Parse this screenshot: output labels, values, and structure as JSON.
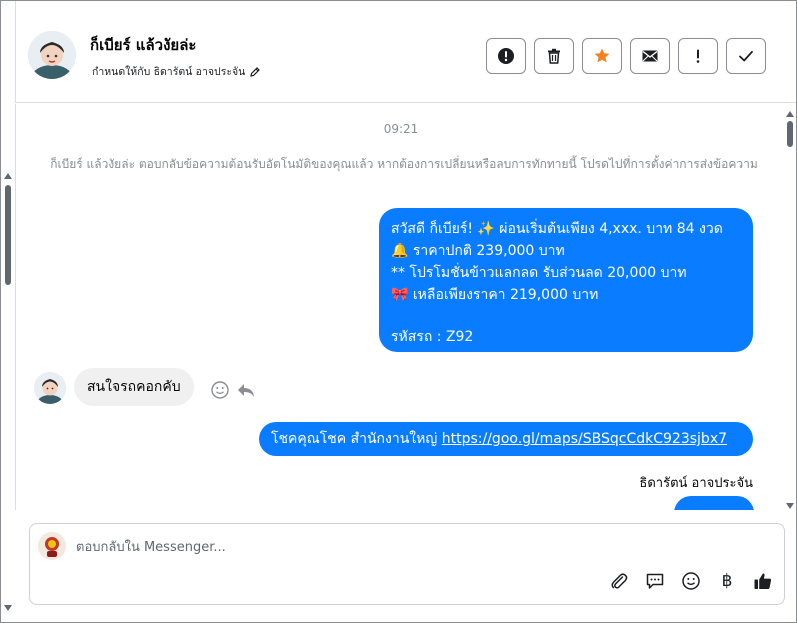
{
  "header": {
    "contact_name": "ก็เบียร์ แล้วงัยล่ะ",
    "assign_text": "กำหนดให้กับ ธิดารัตน์ อาจประจัน"
  },
  "toolbar": {
    "buttons": [
      {
        "name": "spam-button",
        "icon": "exclamation-circle-icon"
      },
      {
        "name": "delete-button",
        "icon": "trash-icon"
      },
      {
        "name": "star-button",
        "icon": "star-icon",
        "color": "#f58220"
      },
      {
        "name": "mark-unread-button",
        "icon": "envelope-icon"
      },
      {
        "name": "follow-up-button",
        "icon": "exclamation-icon"
      },
      {
        "name": "mark-done-button",
        "icon": "check-icon"
      }
    ]
  },
  "conversation": {
    "timestamp": "09:21",
    "system_message": "ก็เบียร์ แล้วงัยล่ะ ตอบกลับข้อความต้อนรับอัตโนมัติของคุณแล้ว หากต้องการเปลี่ยนหรือลบการทักทายนี้ โปรดไปที่การตั้งค่าการส่งข้อความ",
    "promo_message": {
      "line1": "สวัสดี ก็เบียร์! ✨   ผ่อนเริ่มต้นเพียง 4,xxx. บาท 84 งวด",
      "line2": "🔔 ราคาปกติ 239,000 บาท",
      "line3": "** โปรโมชั่นข้าวแลกลด รับส่วนลด 20,000 บาท",
      "line4": "🎀  เหลือเพียงราคา 219,000 บาท",
      "line5": " รหัสรถ : Z92"
    },
    "incoming_message": "สนใจรถคอกคับ",
    "link_message_prefix": "โชคคุณโชค สำนักงานใหญ่ ",
    "link_message_url": "https://goo.gl/maps/SBSqcCdkC923sjbx7",
    "sender_name": "ธิดารัตน์ อาจประจัน"
  },
  "composer": {
    "placeholder": "ตอบกลับใน Messenger...",
    "currency_symbol": "฿"
  },
  "colors": {
    "accent": "#0a7cff",
    "incoming_bubble": "#f0f0f0",
    "muted_text": "#8a8d91"
  }
}
